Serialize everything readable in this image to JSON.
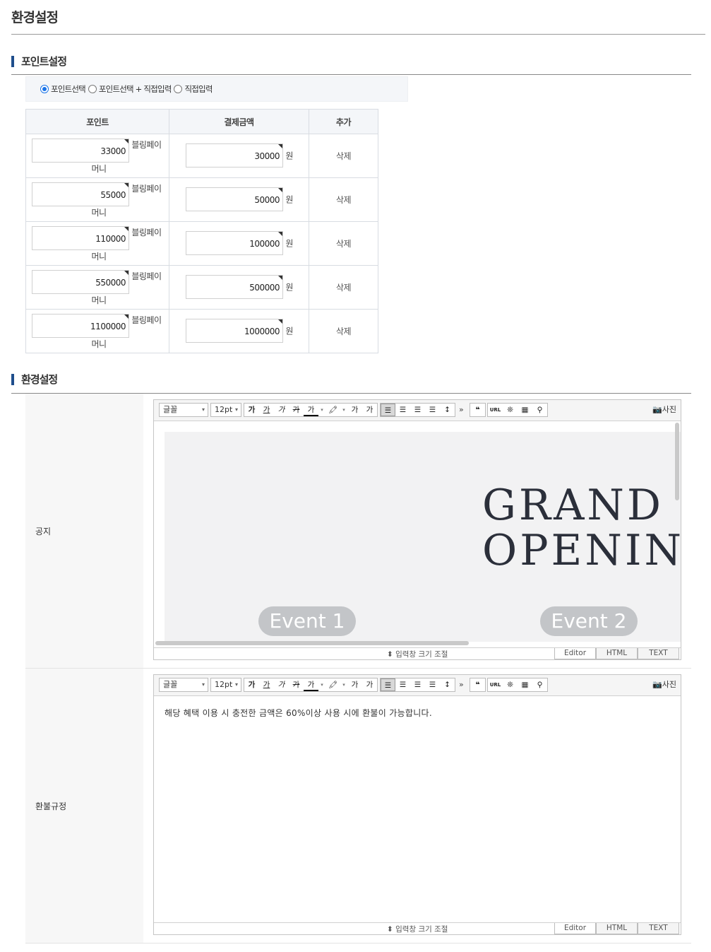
{
  "page": {
    "title": "환경설정"
  },
  "point_section": {
    "title": "포인트설정",
    "radio_options": [
      {
        "label": "포인트선택",
        "checked": true
      },
      {
        "label": "포인트선택 + 직접입력",
        "checked": false
      },
      {
        "label": "직접입력",
        "checked": false
      }
    ],
    "table": {
      "headers": [
        "포인트",
        "결제금액",
        "추가"
      ],
      "point_unit_1": "블링페이",
      "point_unit_2": "머니",
      "pay_unit": "원",
      "rows": [
        {
          "point": "33000",
          "pay": "30000",
          "action": "삭제"
        },
        {
          "point": "55000",
          "pay": "50000",
          "action": "삭제"
        },
        {
          "point": "110000",
          "pay": "100000",
          "action": "삭제"
        },
        {
          "point": "550000",
          "pay": "500000",
          "action": "삭제"
        },
        {
          "point": "1100000",
          "pay": "1000000",
          "action": "삭제"
        }
      ]
    }
  },
  "config_section": {
    "title": "환경설정",
    "notice_label": "공지",
    "refund_label": "환불규정"
  },
  "editor": {
    "font_select": "글꼴",
    "size_select": "12pt",
    "photo_button": "사진",
    "resize_label": "⬍ 입력창 크기 조절",
    "modes": [
      "Editor",
      "HTML",
      "TEXT"
    ],
    "format_buttons": [
      "가",
      "가",
      "가",
      "가",
      "가",
      "가",
      "가",
      "가"
    ],
    "url_button": "URL"
  },
  "notice_content": {
    "banner_line1": "GRAND",
    "banner_line2": "OPENING",
    "event1": "Event 1",
    "event2": "Event 2"
  },
  "refund_content": {
    "text": "해당 혜택 이용 시 충전한 금액은 60%이상 사용 시에 환불이 가능합니다."
  }
}
